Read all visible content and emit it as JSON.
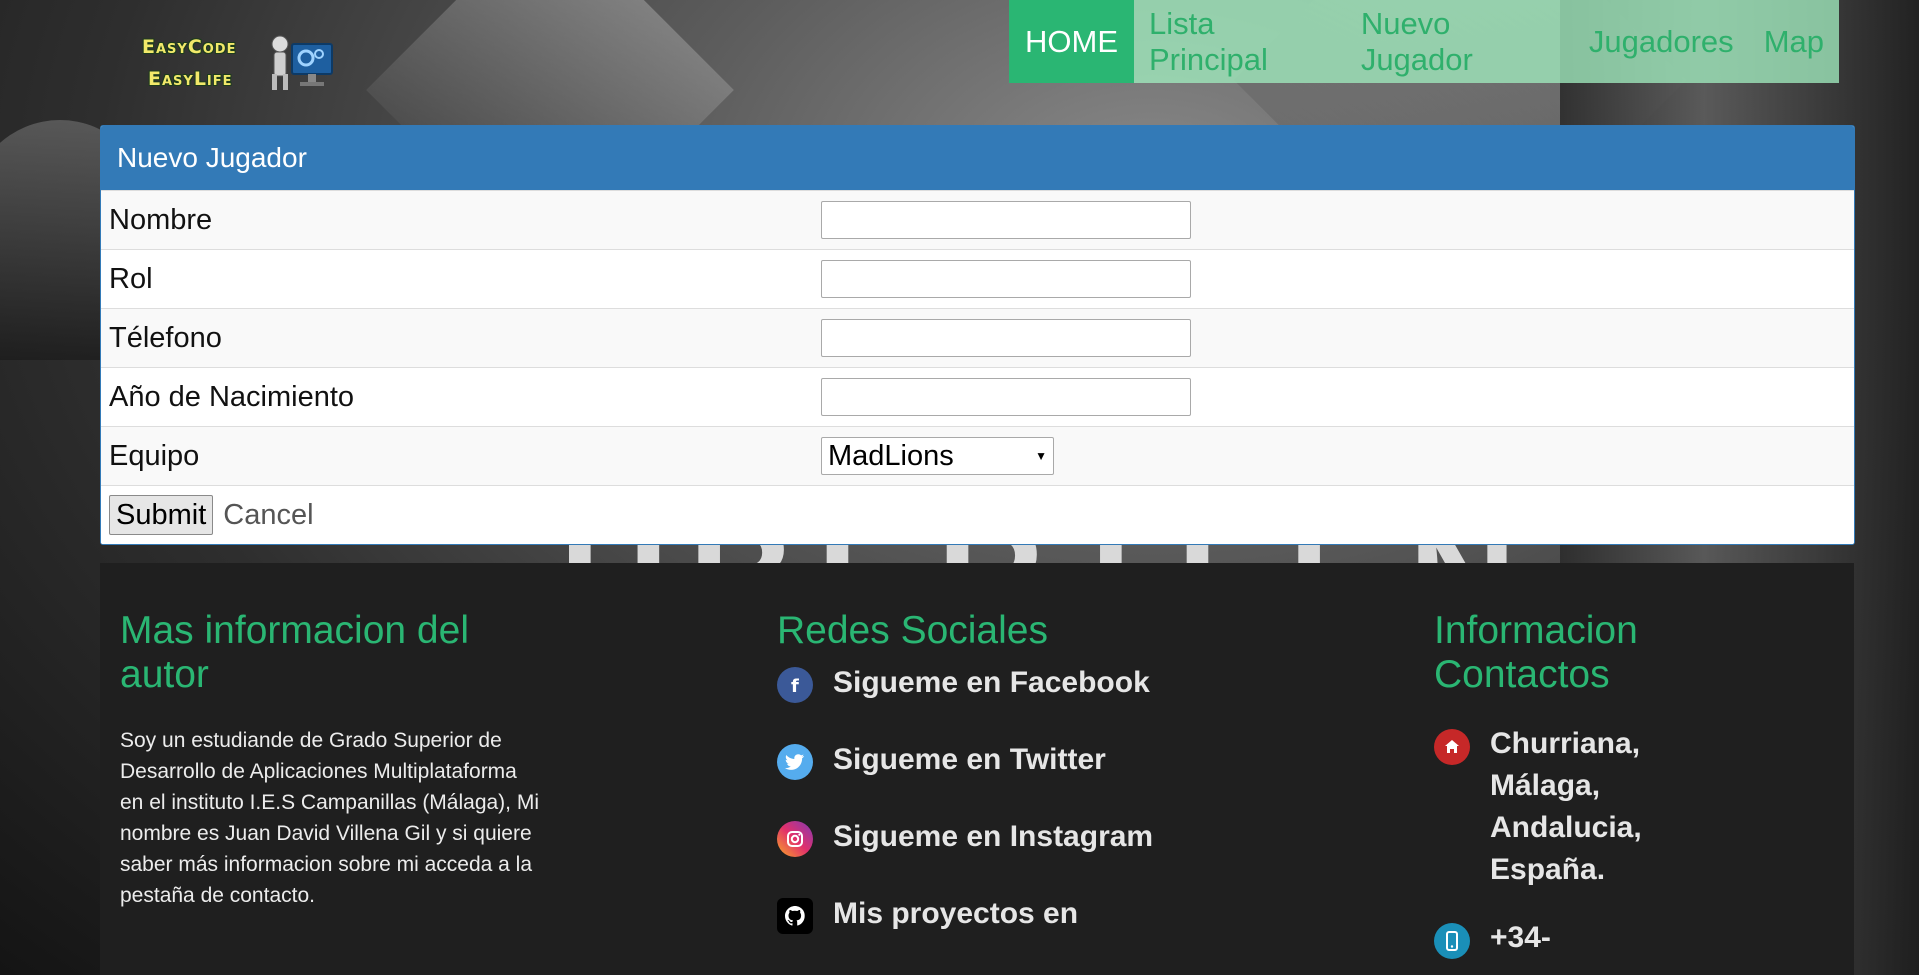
{
  "logo": {
    "line1": "EasyCode",
    "line2": "EasyLife"
  },
  "nav": {
    "items": [
      {
        "label": "HOME",
        "active": true
      },
      {
        "label": "Lista Principal"
      },
      {
        "label": "Nuevo Jugador"
      },
      {
        "label": "Jugadores"
      },
      {
        "label": "Map"
      }
    ]
  },
  "form": {
    "title": "Nuevo Jugador",
    "fields": [
      {
        "label": "Nombre",
        "value": ""
      },
      {
        "label": "Rol",
        "value": ""
      },
      {
        "label": "Télefono",
        "value": ""
      },
      {
        "label": "Año de Nacimiento",
        "value": ""
      },
      {
        "label": "Equipo",
        "selected": "MadLions"
      }
    ],
    "submit_label": "Submit",
    "cancel_label": "Cancel"
  },
  "footer": {
    "about": {
      "title": "Mas informacion del autor",
      "text": "Soy un estudiande de Grado Superior de Desarrollo de Aplicaciones Multiplataforma en el instituto I.E.S Campanillas (Málaga), Mi nombre es Juan David Villena Gil y si quiere saber más informacion sobre mi acceda a la pestaña de contacto."
    },
    "social": {
      "title": "Redes Sociales",
      "items": [
        {
          "label": "Sigueme en Facebook",
          "icon": "facebook-icon",
          "color": "#3b5998"
        },
        {
          "label": "Sigueme en Twitter",
          "icon": "twitter-icon",
          "color": "#55acee"
        },
        {
          "label": "Sigueme en Instagram",
          "icon": "instagram-icon",
          "color": "#c13584"
        },
        {
          "label": "Mis proyectos en",
          "icon": "github-icon",
          "color": "#000000"
        }
      ]
    },
    "contact": {
      "title": "Informacion Contactos",
      "address": "Churriana, Málaga, Andalucia, España.",
      "phone": "+34-"
    }
  },
  "colors": {
    "accent": "#2ab673",
    "panel": "#337ab7",
    "footer_bg": "#1f1f1f"
  }
}
